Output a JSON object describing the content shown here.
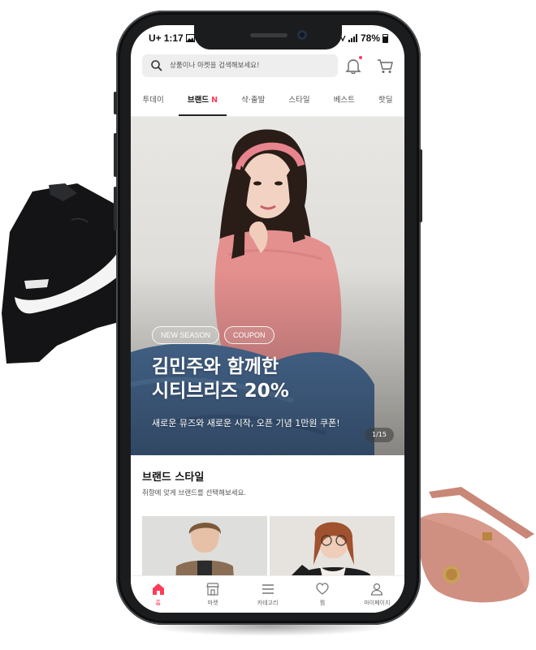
{
  "status_bar": {
    "carrier": "U+",
    "time": "1:17",
    "battery": "78%"
  },
  "search": {
    "placeholder": "상품이나 마켓을 검색해보세요!"
  },
  "tabs": [
    {
      "label": "투데이"
    },
    {
      "label": "브랜드",
      "badge": "N",
      "active": true
    },
    {
      "label": "샥·출발"
    },
    {
      "label": "스타일"
    },
    {
      "label": "베스트"
    },
    {
      "label": "핫딜"
    }
  ],
  "banner": {
    "chips": [
      "NEW SEASON",
      "COUPON"
    ],
    "title_line1": "김민주와 함께한",
    "title_line2": "시티브리즈 20%",
    "subtitle": "새로운 뮤즈와 새로운 시작, 오픈 기념 1만원 쿠폰!",
    "pager": "1/15"
  },
  "brand_style": {
    "title": "브랜드 스타일",
    "subtitle": "취향에 맞게 브랜드를 선택해보세요."
  },
  "bottom_nav": [
    {
      "label": "홈",
      "icon": "home-icon",
      "active": true
    },
    {
      "label": "마켓",
      "icon": "store-icon"
    },
    {
      "label": "카테고리",
      "icon": "menu-icon"
    },
    {
      "label": "찜",
      "icon": "heart-icon"
    },
    {
      "label": "마이페이지",
      "icon": "user-icon"
    }
  ],
  "colors": {
    "accent": "#ff3b5c",
    "phone_frame": "#1b1c1e",
    "bag": "#d89a8c"
  }
}
